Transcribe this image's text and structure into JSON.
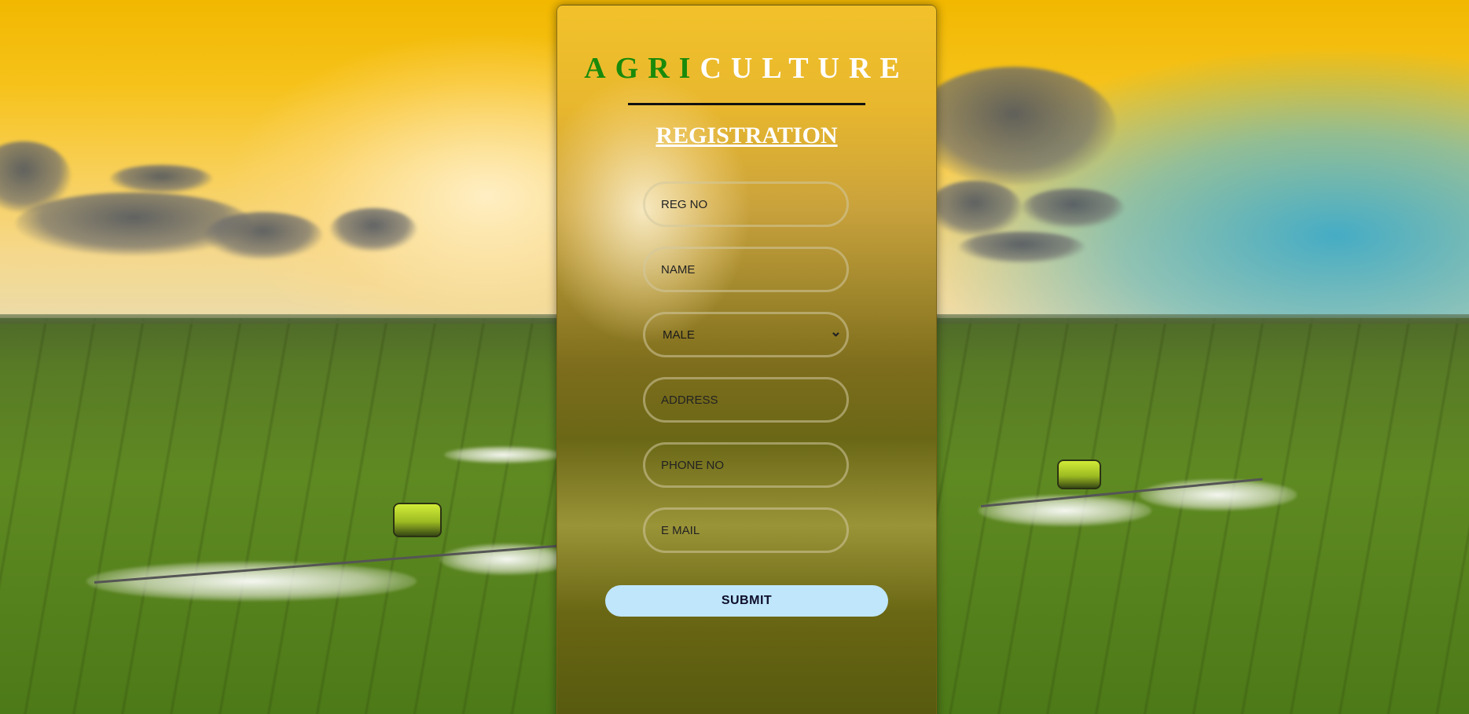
{
  "brand": {
    "title_part1": "AGRI",
    "title_part2": "CULTURE"
  },
  "form": {
    "heading": "REGISTRATION",
    "reg_no_placeholder": "REG NO",
    "name_placeholder": "NAME",
    "gender_selected": "MALE",
    "address_placeholder": "ADDRESS",
    "phone_placeholder": "PHONE NO",
    "email_placeholder": "E MAIL",
    "submit_label": "SUBMIT"
  },
  "icons": {
    "select_chevron": "chevron-down-icon"
  },
  "colors": {
    "brand_green": "#1a8a0a",
    "brand_white": "#ffffff",
    "submit_bg": "#bfe6fb"
  }
}
